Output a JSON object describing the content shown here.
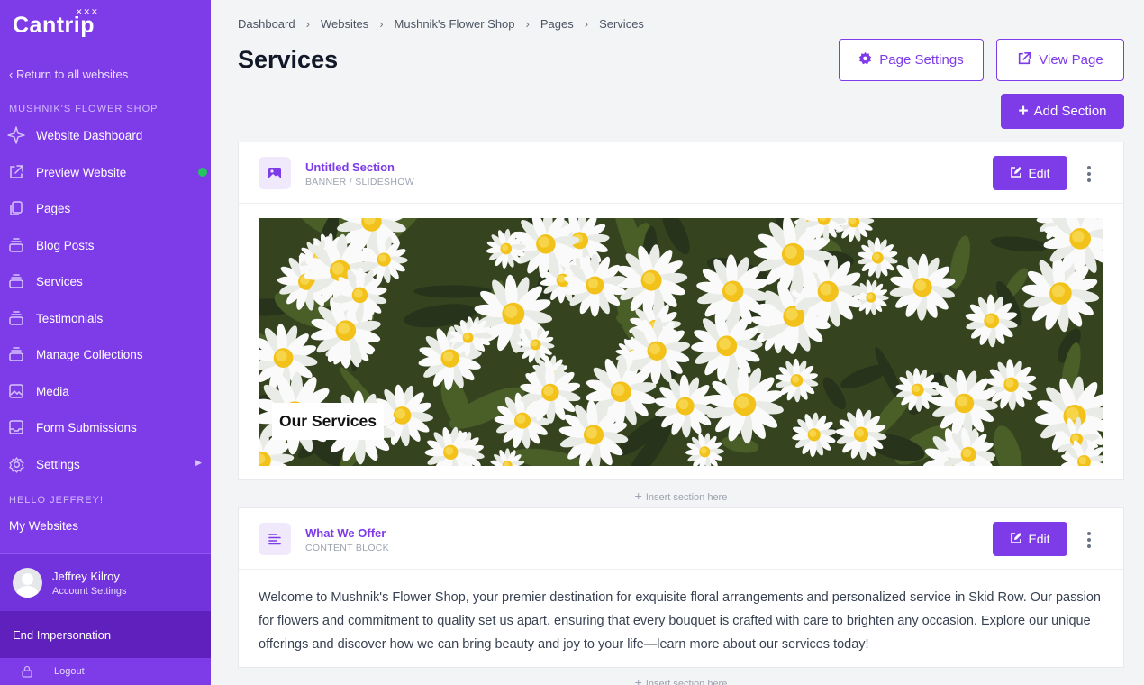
{
  "sidebar": {
    "logo": "Cantrip",
    "return_link": "‹ Return to all websites",
    "site_section_label": "MUSHNIK'S FLOWER SHOP",
    "items": [
      {
        "label": "Website Dashboard",
        "icon": "sparkle-icon"
      },
      {
        "label": "Preview Website",
        "icon": "external-link-icon",
        "status_color": "#22c55e"
      },
      {
        "label": "Pages",
        "icon": "pages-icon"
      },
      {
        "label": "Blog Posts",
        "icon": "collection-icon"
      },
      {
        "label": "Services",
        "icon": "collection-icon"
      },
      {
        "label": "Testimonials",
        "icon": "collection-icon"
      },
      {
        "label": "Manage Collections",
        "icon": "collection-icon"
      },
      {
        "label": "Media",
        "icon": "image-icon"
      },
      {
        "label": "Form Submissions",
        "icon": "inbox-icon"
      },
      {
        "label": "Settings",
        "icon": "gear-icon",
        "has_submenu": true
      }
    ],
    "hello_label": "HELLO JEFFREY!",
    "my_websites": "My Websites",
    "user": {
      "name": "Jeffrey Kilroy",
      "sub": "Account Settings"
    },
    "end_impersonation": "End Impersonation",
    "logout": "Logout"
  },
  "header": {
    "breadcrumb": [
      "Dashboard",
      "Websites",
      "Mushnik's Flower Shop",
      "Pages",
      "Services"
    ],
    "title": "Services",
    "page_settings": "Page Settings",
    "view_page": "View Page",
    "add_section": "Add Section"
  },
  "sections": [
    {
      "title": "Untitled Section",
      "type": "BANNER / SLIDESHOW",
      "edit": "Edit",
      "banner_text": "Our Services"
    },
    {
      "title": "What We Offer",
      "type": "CONTENT BLOCK",
      "edit": "Edit",
      "body": "Welcome to Mushnik's Flower Shop, your premier destination for exquisite floral arrangements and personalized service in Skid Row. Our passion for flowers and commitment to quality set us apart, ensuring that every bouquet is crafted with care to brighten any occasion. Explore our unique offerings and discover how we can bring beauty and joy to your life—learn more about our services today!"
    }
  ],
  "insert_label": "Insert section here",
  "colors": {
    "accent": "#7e3be8",
    "sidebar": "#7e3be8",
    "status_online": "#22c55e"
  }
}
